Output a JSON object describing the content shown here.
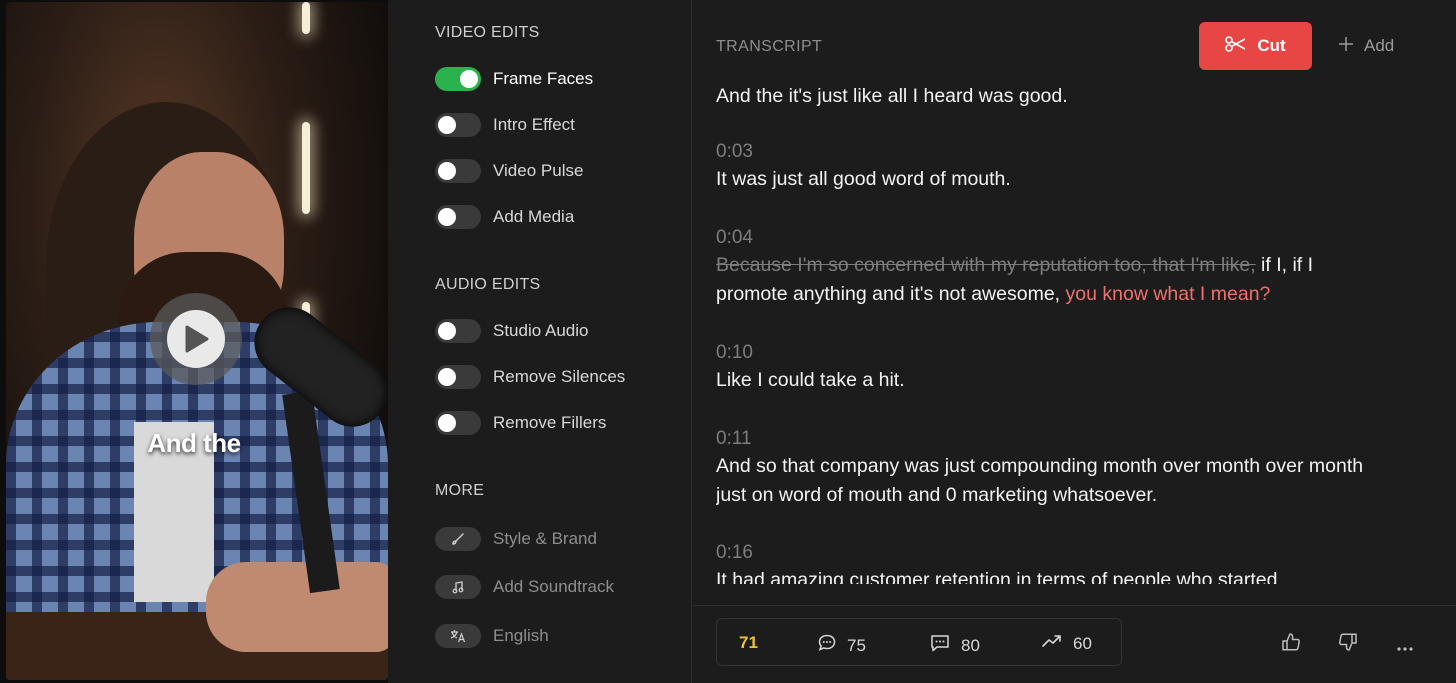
{
  "video": {
    "caption": "And the"
  },
  "edits": {
    "video_section_title": "VIDEO EDITS",
    "video_options": [
      {
        "label": "Frame Faces",
        "on": true
      },
      {
        "label": "Intro Effect",
        "on": false
      },
      {
        "label": "Video Pulse",
        "on": false
      },
      {
        "label": "Add Media",
        "on": false
      }
    ],
    "audio_section_title": "AUDIO EDITS",
    "audio_options": [
      {
        "label": "Studio Audio",
        "on": false
      },
      {
        "label": "Remove Silences",
        "on": false
      },
      {
        "label": "Remove Fillers",
        "on": false
      }
    ],
    "more_section_title": "MORE",
    "more_options": [
      {
        "label": "Style & Brand",
        "icon": "brush-icon"
      },
      {
        "label": "Add Soundtrack",
        "icon": "music-note-icon"
      },
      {
        "label": "English",
        "icon": "translate-icon"
      }
    ]
  },
  "transcript": {
    "title": "TRANSCRIPT",
    "cut_label": "Cut",
    "add_label": "Add",
    "segments": [
      {
        "time": "",
        "text": "And the it's just like all I heard was good."
      },
      {
        "time": "0:03",
        "text": "It was just all good word of mouth."
      },
      {
        "time": "0:04",
        "struck": "Because I'm so concerned with my reputation too, that I'm like,",
        "text_a": " if I, if I",
        "text_b": "promote anything and it's not awesome, ",
        "highlight": "you know what I mean?"
      },
      {
        "time": "0:10",
        "text": "Like I could take a hit."
      },
      {
        "time": "0:11",
        "text": "And so that company was just compounding month over month over month",
        "text2": "just on word of mouth and 0 marketing whatsoever."
      },
      {
        "time": "0:16",
        "text": "It had amazing customer retention in terms of people who started"
      }
    ]
  },
  "footer": {
    "score": "71",
    "metric_1": "75",
    "metric_2": "80",
    "metric_3": "60"
  },
  "colors": {
    "accent_red": "#e84545",
    "toggle_on": "#2bb24c",
    "score_yellow": "#f1c232",
    "highlight_red": "#f0706d"
  }
}
